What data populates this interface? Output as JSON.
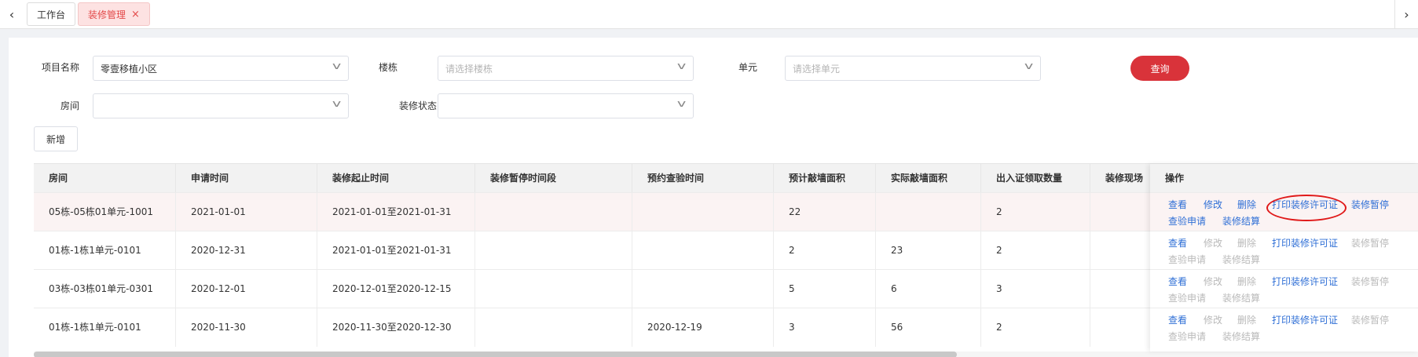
{
  "tabs": [
    {
      "label": "工作台",
      "active": false
    },
    {
      "label": "装修管理",
      "active": true,
      "close": "×"
    }
  ],
  "filters": {
    "project": {
      "label": "项目名称",
      "value": "零壹移植小区"
    },
    "building": {
      "label": "楼栋",
      "placeholder": "请选择楼栋"
    },
    "unit": {
      "label": "单元",
      "placeholder": "请选择单元"
    },
    "room": {
      "label": "房间",
      "value": ""
    },
    "status": {
      "label": "装修状态",
      "value": ""
    }
  },
  "buttons": {
    "query": "查询",
    "add": "新增"
  },
  "table": {
    "columns": [
      "房间",
      "申请时间",
      "装修起止时间",
      "装修暂停时间段",
      "预约查验时间",
      "预计敲墙面积",
      "实际敲墙面积",
      "出入证领取数量",
      "装修现场"
    ],
    "action_header": "操作",
    "rows": [
      {
        "cells": [
          "05栋-05栋01单元-1001",
          "2021-01-01",
          "2021-01-01至2021-01-31",
          "",
          "",
          "22",
          "",
          "2",
          ""
        ]
      },
      {
        "cells": [
          "01栋-1栋1单元-0101",
          "2020-12-31",
          "2021-01-01至2021-01-31",
          "",
          "",
          "2",
          "23",
          "2",
          ""
        ]
      },
      {
        "cells": [
          "03栋-03栋01单元-0301",
          "2020-12-01",
          "2020-12-01至2020-12-15",
          "",
          "",
          "5",
          "6",
          "3",
          ""
        ]
      },
      {
        "cells": [
          "01栋-1栋1单元-0101",
          "2020-11-30",
          "2020-11-30至2020-12-30",
          "",
          "2020-12-19",
          "3",
          "56",
          "2",
          ""
        ]
      }
    ],
    "actions": [
      [
        "查看",
        "修改",
        "删除",
        "打印装修许可证",
        "装修暂停",
        "查验申请",
        "装修结算"
      ],
      [
        "查看",
        "修改",
        "删除",
        "打印装修许可证",
        "装修暂停",
        "查验申请",
        "装修结算"
      ],
      [
        "查看",
        "修改",
        "删除",
        "打印装修许可证",
        "装修暂停",
        "查验申请",
        "装修结算"
      ],
      [
        "查看",
        "修改",
        "删除",
        "打印装修许可证",
        "装修暂停",
        "查验申请",
        "装修结算"
      ]
    ],
    "actions_enabled": [
      [
        true,
        true,
        true,
        true,
        true,
        true,
        true
      ],
      [
        true,
        false,
        false,
        true,
        false,
        false,
        false
      ],
      [
        true,
        false,
        false,
        true,
        false,
        false,
        false
      ],
      [
        true,
        false,
        false,
        true,
        false,
        false,
        false
      ]
    ]
  },
  "colors": {
    "accent": "#d9333a",
    "link": "#2f6fd6",
    "annotation": "#e01919"
  }
}
